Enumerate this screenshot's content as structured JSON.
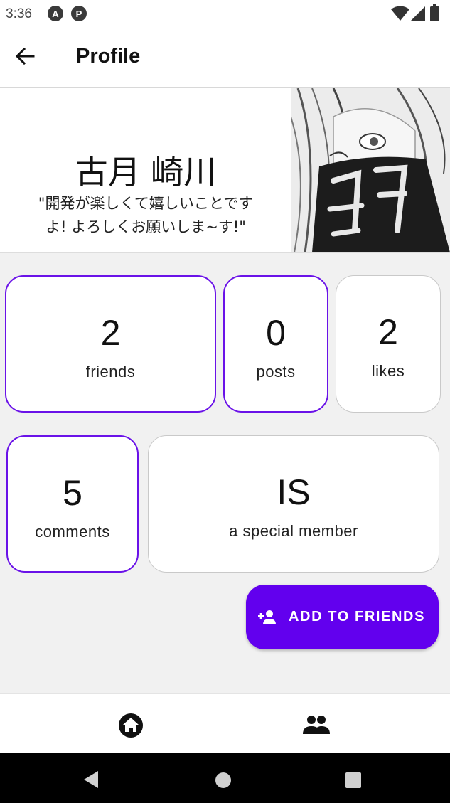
{
  "status_bar": {
    "time": "3:36",
    "icons": [
      "app-notification-icon",
      "app-notification-icon-2",
      "wifi-icon",
      "signal-icon",
      "battery-icon"
    ]
  },
  "app_bar": {
    "title": "Profile",
    "back_icon": "arrow-back-icon"
  },
  "profile": {
    "name": "古月 崎川",
    "bio_line1": "\"開発が楽しくて嬉しいことです",
    "bio_line2": "よ! よろしくお願いしま~す!\""
  },
  "stats": [
    {
      "value": "2",
      "label": "friends"
    },
    {
      "value": "0",
      "label": "posts"
    },
    {
      "value": "2",
      "label": "likes"
    },
    {
      "value": "5",
      "label": "comments"
    },
    {
      "value": "IS",
      "label": "a special member"
    }
  ],
  "action": {
    "label": "ADD TO FRIENDS",
    "icon": "person-add-icon"
  },
  "bottom_nav": {
    "items": [
      "home-icon",
      "people-icon"
    ]
  },
  "system_nav": [
    "back-triangle-icon",
    "home-circle-icon",
    "recents-square-icon"
  ],
  "colors": {
    "accent": "#6200ee",
    "card_border_accent": "#6a12e8",
    "card_border": "#c9c9c9",
    "background": "#f1f1f1"
  }
}
